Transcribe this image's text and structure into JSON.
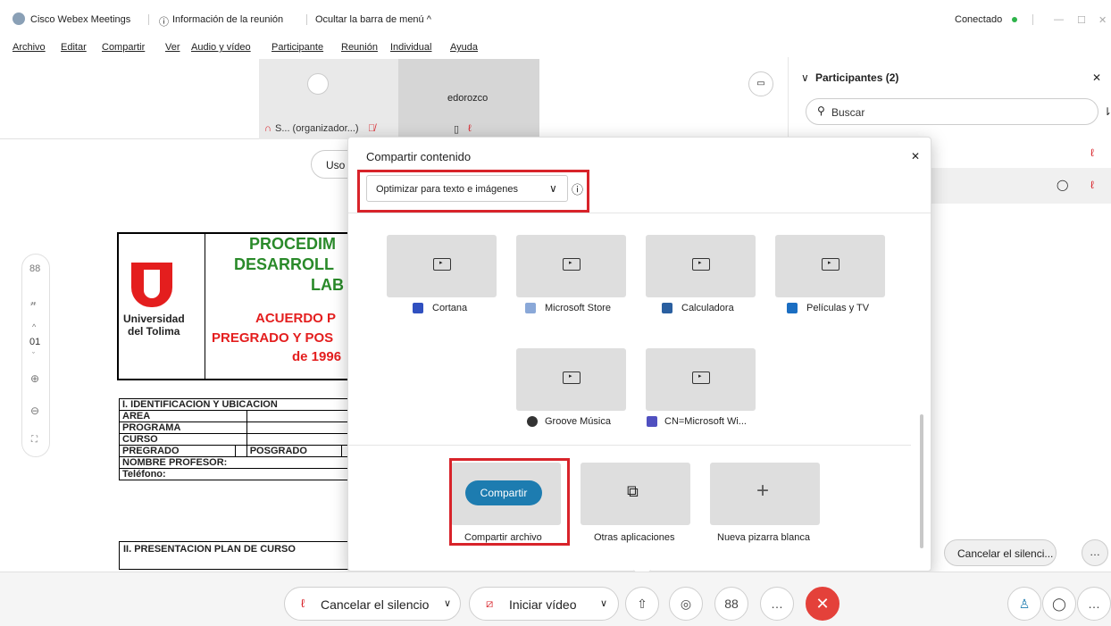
{
  "titlebar": {
    "app_name": "Cisco Webex Meetings",
    "meeting_info": "Información de la reunión",
    "hide_menu": "Ocultar la barra de menú ^",
    "status": "Conectado"
  },
  "menu": [
    "Archivo",
    "Editar",
    "Compartir",
    "Ver",
    "Audio y vídeo",
    "Participante",
    "Reunión",
    "Individual",
    "Ayuda"
  ],
  "video": {
    "self_label": "S... (organizador...)",
    "other_name": "edorozco"
  },
  "doc": {
    "heading1": "PROCEDIM",
    "heading2": "DESARROLL",
    "heading3": "LAB",
    "sub1": "ACUERDO P",
    "sub2": "PREGRADO Y POS",
    "sub3": "de 1996",
    "logo_l1": "Universidad",
    "logo_l2": "del Tolima",
    "uso": "Uso",
    "rows": [
      "I. IDENTIFICACION Y UBICACION",
      "AREA",
      "PROGRAMA",
      "CURSO",
      "PREGRADO",
      "POSGRADO",
      "NOMBRE PROFESOR:",
      "Teléfono:"
    ],
    "section2": "II. PRESENTACION PLAN DE CURSO",
    "page": "01"
  },
  "panel": {
    "title": "Participantes (2)",
    "search_placeholder": "Buscar",
    "cancel_mute": "Cancelar el silenci..."
  },
  "modal": {
    "title": "Compartir contenido",
    "optimize": "Optimizar para texto e imágenes",
    "apps": [
      "Cortana",
      "Microsoft Store",
      "Calculadora",
      "Películas y TV",
      "Groove Música",
      "CN=Microsoft Wi..."
    ],
    "share_button": "Compartir",
    "share_file": "Compartir archivo",
    "other_apps": "Otras aplicaciones",
    "whiteboard": "Nueva pizarra blanca"
  },
  "bottom": {
    "mute": "Cancelar el silencio",
    "video": "Iniciar vídeo"
  },
  "colors": {
    "accent": "#1d7cb0",
    "red": "#d8232a",
    "doc_green": "#2a8a2a",
    "doc_red": "#e41e1e"
  }
}
